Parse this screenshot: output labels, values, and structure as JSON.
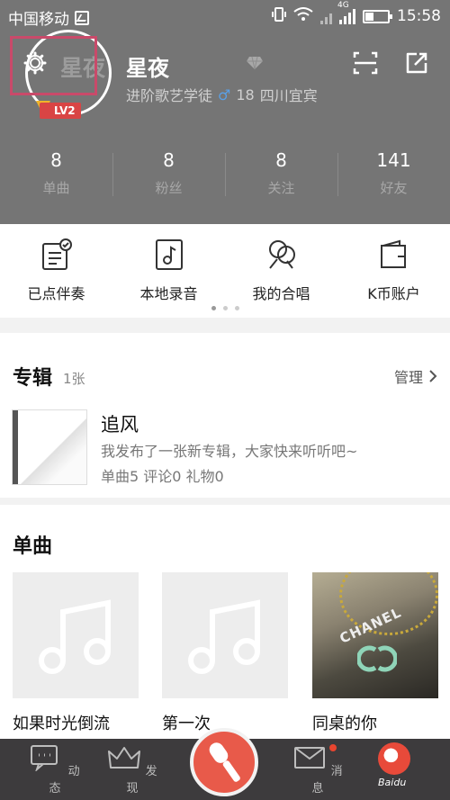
{
  "status_bar": {
    "carrier": "中国移动",
    "network": "4G",
    "time": "15:58"
  },
  "profile": {
    "avatar_text": "星夜",
    "nickname": "星夜",
    "level": "LV2",
    "title": "进阶歌艺学徒",
    "gender_icon": "male-icon",
    "age": "18",
    "location": "四川宜宾"
  },
  "stats": [
    {
      "value": "8",
      "label": "单曲"
    },
    {
      "value": "8",
      "label": "粉丝"
    },
    {
      "value": "8",
      "label": "关注"
    },
    {
      "value": "141",
      "label": "好友"
    }
  ],
  "quick_menu": [
    {
      "label": "已点伴奏",
      "icon": "list-check-icon"
    },
    {
      "label": "本地录音",
      "icon": "music-file-icon"
    },
    {
      "label": "我的合唱",
      "icon": "duet-icon"
    },
    {
      "label": "K币账户",
      "icon": "wallet-icon"
    }
  ],
  "album": {
    "section_title": "专辑",
    "count": "1张",
    "manage_label": "管理",
    "name": "追风",
    "description": "我发布了一张新专辑，大家快来听听吧~",
    "meta": "单曲5 评论0 礼物0"
  },
  "singles": {
    "section_title": "单曲",
    "items": [
      {
        "name": "如果时光倒流"
      },
      {
        "name": "第一次"
      },
      {
        "name": "同桌的你",
        "cover_text": "CHANEL"
      }
    ]
  },
  "bottom_nav": [
    {
      "label": "动态",
      "icon": "chat-bubble-icon"
    },
    {
      "label": "发现",
      "icon": "crown-icon"
    },
    {
      "label": "",
      "icon": "microphone-icon"
    },
    {
      "label": "消息",
      "icon": "envelope-icon"
    },
    {
      "label": "",
      "icon": "avatar-icon"
    }
  ],
  "watermark": "Baidu"
}
